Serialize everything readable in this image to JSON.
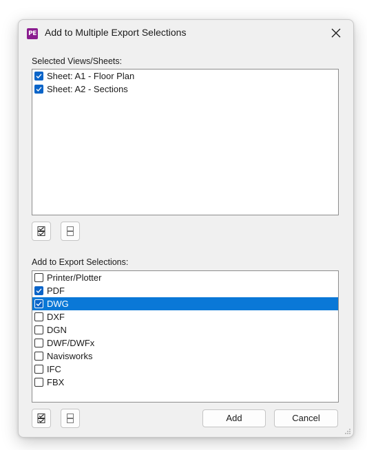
{
  "dialog": {
    "title": "Add to Multiple Export Selections",
    "app_icon_text": "PE",
    "close_glyph": "✕"
  },
  "views_section": {
    "label": "Selected Views/Sheets:",
    "items": [
      {
        "label": "Sheet: A1 - Floor Plan",
        "checked": true
      },
      {
        "label": "Sheet: A2 - Sections",
        "checked": true
      }
    ],
    "check_all_icon": "check-all-icon",
    "uncheck_all_icon": "uncheck-all-icon"
  },
  "export_section": {
    "label": "Add to Export Selections:",
    "items": [
      {
        "label": "Printer/Plotter",
        "checked": false,
        "selected": false
      },
      {
        "label": "PDF",
        "checked": true,
        "selected": false
      },
      {
        "label": "DWG",
        "checked": true,
        "selected": true
      },
      {
        "label": "DXF",
        "checked": false,
        "selected": false
      },
      {
        "label": "DGN",
        "checked": false,
        "selected": false
      },
      {
        "label": "DWF/DWFx",
        "checked": false,
        "selected": false
      },
      {
        "label": "Navisworks",
        "checked": false,
        "selected": false
      },
      {
        "label": "IFC",
        "checked": false,
        "selected": false
      },
      {
        "label": "FBX",
        "checked": false,
        "selected": false
      }
    ],
    "check_all_icon": "check-all-icon",
    "uncheck_all_icon": "uncheck-all-icon"
  },
  "buttons": {
    "add_label": "Add",
    "cancel_label": "Cancel"
  },
  "colors": {
    "selection": "#0a78d7",
    "checkbox_checked": "#0a64c8",
    "app_icon": "#8a1c8f",
    "dialog_bg": "#f0f0f0"
  }
}
